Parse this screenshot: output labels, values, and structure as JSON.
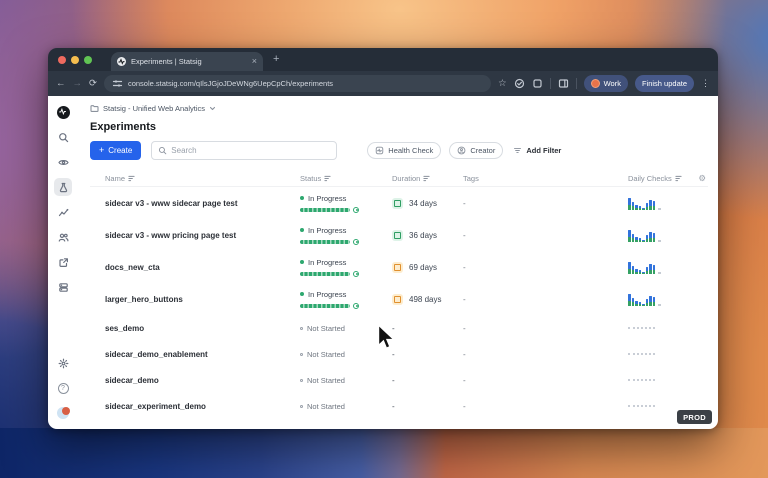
{
  "browser": {
    "tab_title": "Experiments | Statsig",
    "url": "console.statsig.com/qIlsJGjoJDeWNg6UepCpCh/experiments",
    "profile_label": "Work",
    "update_label": "Finish update",
    "glyphs": {
      "close": "×",
      "new_tab": "+",
      "back": "←",
      "forward": "→",
      "reload": "⟳",
      "star": "☆",
      "overflow": "⋮"
    }
  },
  "app": {
    "project_name": "Statsig - Unified Web Analytics",
    "page_title": "Experiments",
    "create_label": "Create",
    "create_plus": "+",
    "search_placeholder": "Search",
    "filters": {
      "health": "Health Check",
      "creator": "Creator",
      "add": "Add Filter"
    },
    "env_badge": "PROD",
    "help_glyph": "?",
    "gear_glyph": "⚙",
    "sidebar_icons": [
      "statsig-logo",
      "search",
      "feature-gates",
      "experiments",
      "metrics",
      "audiences",
      "integrations",
      "storage",
      "settings",
      "help",
      "account"
    ],
    "table": {
      "columns": {
        "name": "Name",
        "status": "Status",
        "duration": "Duration",
        "tags": "Tags",
        "daily_checks": "Daily Checks"
      },
      "rows": [
        {
          "name": "sidecar v3 - www sidecar page test",
          "status": "In Progress",
          "duration": "34 days",
          "badge": "green",
          "tags": "-"
        },
        {
          "name": "sidecar v3 - www pricing page test",
          "status": "In Progress",
          "duration": "36 days",
          "badge": "green",
          "tags": "-"
        },
        {
          "name": "docs_new_cta",
          "status": "In Progress",
          "duration": "69 days",
          "badge": "orange",
          "tags": "-"
        },
        {
          "name": "larger_hero_buttons",
          "status": "In Progress",
          "duration": "498 days",
          "badge": "orange",
          "tags": "-"
        },
        {
          "name": "ses_demo",
          "status": "Not Started",
          "duration": "-",
          "badge": null,
          "tags": "-"
        },
        {
          "name": "sidecar_demo_enablement",
          "status": "Not Started",
          "duration": "-",
          "badge": null,
          "tags": "-"
        },
        {
          "name": "sidecar_demo",
          "status": "Not Started",
          "duration": "-",
          "badge": null,
          "tags": "-"
        },
        {
          "name": "sidecar_experiment_demo",
          "status": "Not Started",
          "duration": "-",
          "badge": null,
          "tags": "-"
        }
      ],
      "sparkline_bars": [
        [
          12,
          5
        ],
        [
          8,
          4
        ],
        [
          5,
          2
        ],
        [
          4,
          2
        ],
        [
          2,
          1
        ],
        [
          7,
          3
        ],
        [
          10,
          4
        ],
        [
          9,
          4
        ]
      ]
    }
  },
  "colors": {
    "accent_blue": "#2563eb",
    "progress_green": "#2ea86f",
    "badge_green": "#2f9e63",
    "badge_orange": "#e0902f",
    "spark_blue": "#3273dc",
    "spark_green": "#35a164",
    "profile_avatar_orange": "#e8734a"
  }
}
